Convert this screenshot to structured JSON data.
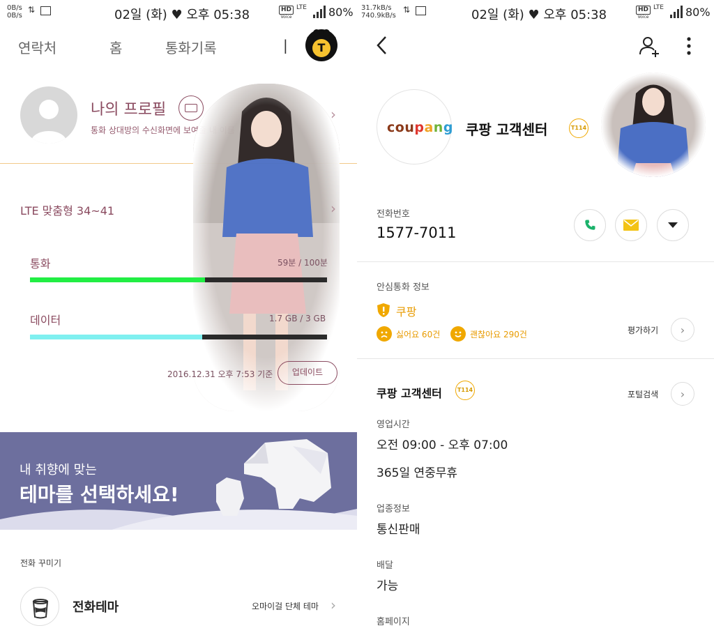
{
  "status_left": {
    "speed_up": "0B/s",
    "speed_down": "0B/s",
    "time": "02일 (화) ♥ 오후 05:38",
    "hd": "HD",
    "hd_sub": "Voice",
    "net": "LTE",
    "battery": "80%"
  },
  "status_right": {
    "speed_up": "31.7kB/s",
    "speed_down": "740.9kB/s",
    "time": "02일 (화) ♥ 오후 05:38",
    "hd": "HD",
    "hd_sub": "Voice",
    "net": "LTE",
    "battery": "80%"
  },
  "left": {
    "tabs": [
      "연락처",
      "홈",
      "통화기록"
    ],
    "divider": "|",
    "t_logo": "T",
    "profile": {
      "title": "나의 프로필",
      "subtitle": "통화 상대방의 수신화면에 보여줄 내 이름"
    },
    "plan": {
      "name": "LTE 맞춤형 34~41"
    },
    "usage": [
      {
        "label": "통화",
        "value": "59분 / 100분",
        "fraction": 0.59,
        "color": "#22ee44"
      },
      {
        "label": "데이터",
        "value": "1.7 GB / 3 GB",
        "fraction": 0.58,
        "color": "#7ff0f0"
      }
    ],
    "updated": "2016.12.31  오후 7:53 기준",
    "update_button": "업데이트",
    "banner": {
      "line1": "내 취향에 맞는",
      "line2": "테마를 선택하세요!"
    },
    "decor_section": "전화 꾸미기",
    "theme_item": {
      "title": "전화테마",
      "value": "오마이걸 단체 테마"
    }
  },
  "right": {
    "company_logo": "coupang",
    "company_name": "쿠팡 고객센터",
    "t114": "T114",
    "phone_label": "전화번호",
    "phone": "1577-7011",
    "safe_label": "안심통화 정보",
    "safe_name": "쿠팡",
    "dislike": "싫어요 60건",
    "like": "괜찮아요 290건",
    "rate": "평가하기",
    "section_title": "쿠팡 고객센터",
    "portal": "포털검색",
    "hours_label": "영업시간",
    "hours": "오전 09:00 - 오후 07:00",
    "hours_note": "365일 연중무휴",
    "biz_label": "업종정보",
    "biz": "통신판매",
    "delivery_label": "배달",
    "delivery": "가능",
    "homepage_label": "홈페이지"
  }
}
